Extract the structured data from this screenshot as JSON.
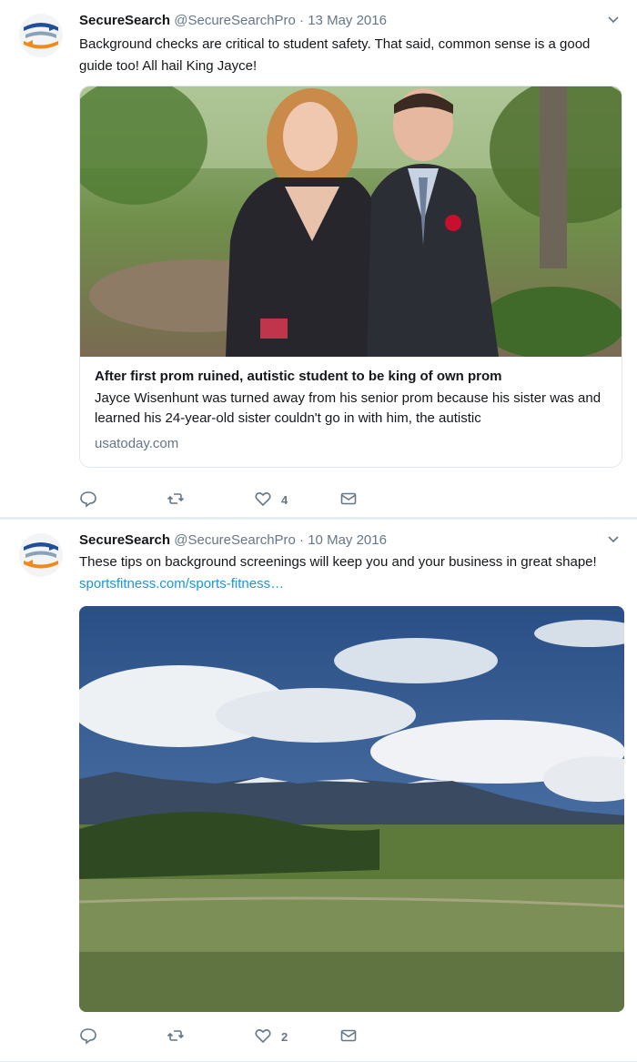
{
  "tweets": [
    {
      "name": "SecureSearch",
      "handle": "@SecureSearchPro",
      "separator": "·",
      "date": "13 May 2016",
      "text": "Background checks are critical to student safety. That said, common sense is a good guide too! All hail King Jayce!",
      "card": {
        "title": "After first prom ruined, autistic student to be king of own prom",
        "description": "Jayce Wisenhunt was turned away from his senior prom because his sister was and learned his 24-year-old sister couldn't go in with him, the autistic",
        "domain": "usatoday.com"
      },
      "actions": {
        "reply_count": "",
        "retweet_count": "",
        "like_count": "4"
      }
    },
    {
      "name": "SecureSearch",
      "handle": "@SecureSearchPro",
      "separator": "·",
      "date": "10 May 2016",
      "text": "These tips on background screenings will keep you and your business in great shape!",
      "link": "sportsfitness.com/sports-fitness…",
      "actions": {
        "reply_count": "",
        "retweet_count": "",
        "like_count": "2"
      }
    }
  ],
  "icons": {
    "avatar": "securesearch-logo-icon",
    "caret": "chevron-down-icon",
    "reply": "reply-icon",
    "retweet": "retweet-icon",
    "like": "heart-icon",
    "message": "envelope-icon"
  },
  "colors": {
    "link": "#1b95e0",
    "muted": "#657786",
    "text": "#14171a",
    "divider": "#e6ecf0"
  }
}
